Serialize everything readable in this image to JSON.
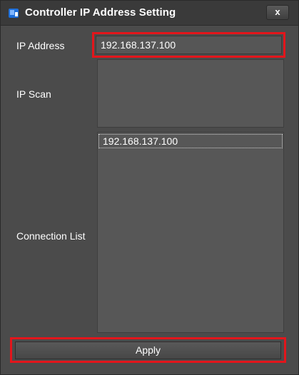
{
  "window": {
    "title": "Controller IP Address Setting",
    "close_label": "x"
  },
  "ip_address": {
    "label": "IP Address",
    "value": "192.168.137.100"
  },
  "ip_scan": {
    "label": "IP Scan"
  },
  "connection_list": {
    "label": "Connection List",
    "items": [
      {
        "label": "192.168.137.100"
      }
    ]
  },
  "apply_button": {
    "label": "Apply"
  },
  "icons": {
    "app": "app-icon",
    "close": "close-icon"
  },
  "colors": {
    "background": "#4b4b4b",
    "titlebar": "#3a3a3a",
    "highlight": "#e3151b",
    "text": "#ffffff"
  }
}
